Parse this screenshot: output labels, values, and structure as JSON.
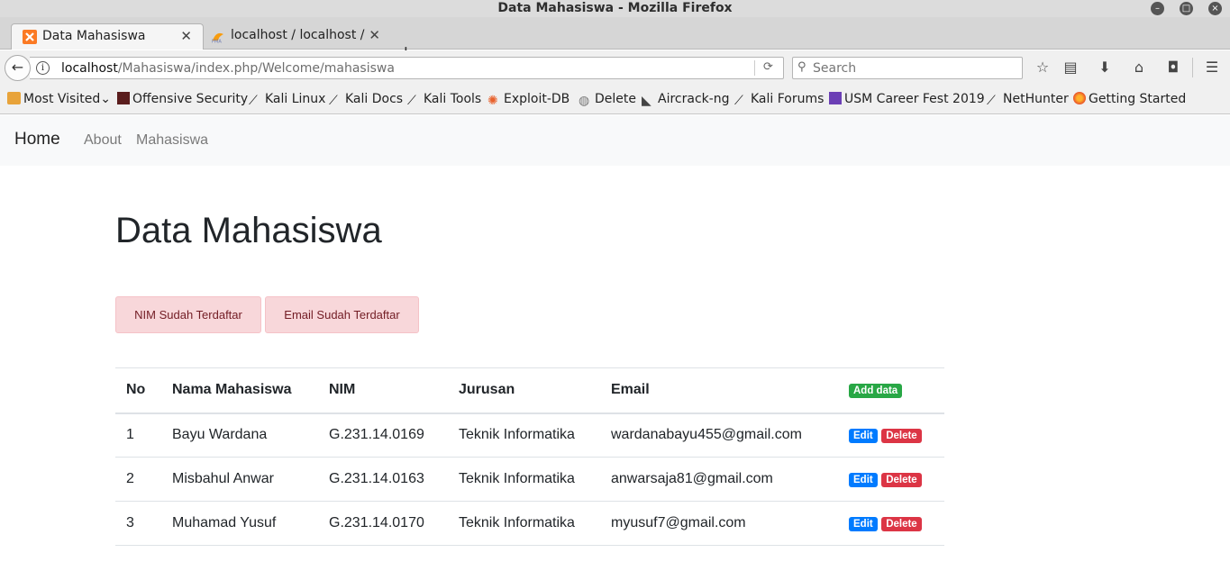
{
  "window": {
    "title": "Data Mahasiswa - Mozilla Firefox"
  },
  "tabs": [
    {
      "label": "Data Mahasiswa",
      "active": true
    },
    {
      "label": "localhost / localhost / ...",
      "active": false
    }
  ],
  "urlbar": {
    "host": "localhost",
    "path": "/Mahasiswa/index.php/Welcome/mahasiswa"
  },
  "search": {
    "placeholder": "Search"
  },
  "bookmarks": [
    "Most Visited",
    "Offensive Security",
    "Kali Linux",
    "Kali Docs",
    "Kali Tools",
    "Exploit-DB",
    "Delete",
    "Aircrack-ng",
    "Kali Forums",
    "USM Career Fest 2019",
    "NetHunter",
    "Getting Started"
  ],
  "site_nav": {
    "brand": "Home",
    "links": [
      "About",
      "Mahasiswa"
    ]
  },
  "page": {
    "title": "Data Mahasiswa",
    "alerts": [
      "NIM Sudah Terdaftar",
      "Email Sudah Terdaftar"
    ]
  },
  "table": {
    "headers": [
      "No",
      "Nama Mahasiswa",
      "NIM",
      "Jurusan",
      "Email"
    ],
    "add_label": "Add data",
    "edit_label": "Edit",
    "delete_label": "Delete",
    "rows": [
      {
        "no": "1",
        "nama": "Bayu Wardana",
        "nim": "G.231.14.0169",
        "jurusan": "Teknik Informatika",
        "email": "wardanabayu455@gmail.com"
      },
      {
        "no": "2",
        "nama": "Misbahul Anwar",
        "nim": "G.231.14.0163",
        "jurusan": "Teknik Informatika",
        "email": "anwarsaja81@gmail.com"
      },
      {
        "no": "3",
        "nama": "Muhamad Yusuf",
        "nim": "G.231.14.0170",
        "jurusan": "Teknik Informatika",
        "email": "myusuf7@gmail.com"
      }
    ]
  },
  "colors": {
    "success": "#28a745",
    "primary": "#007bff",
    "danger": "#dc3545",
    "alert_bg": "#f8d7da"
  }
}
